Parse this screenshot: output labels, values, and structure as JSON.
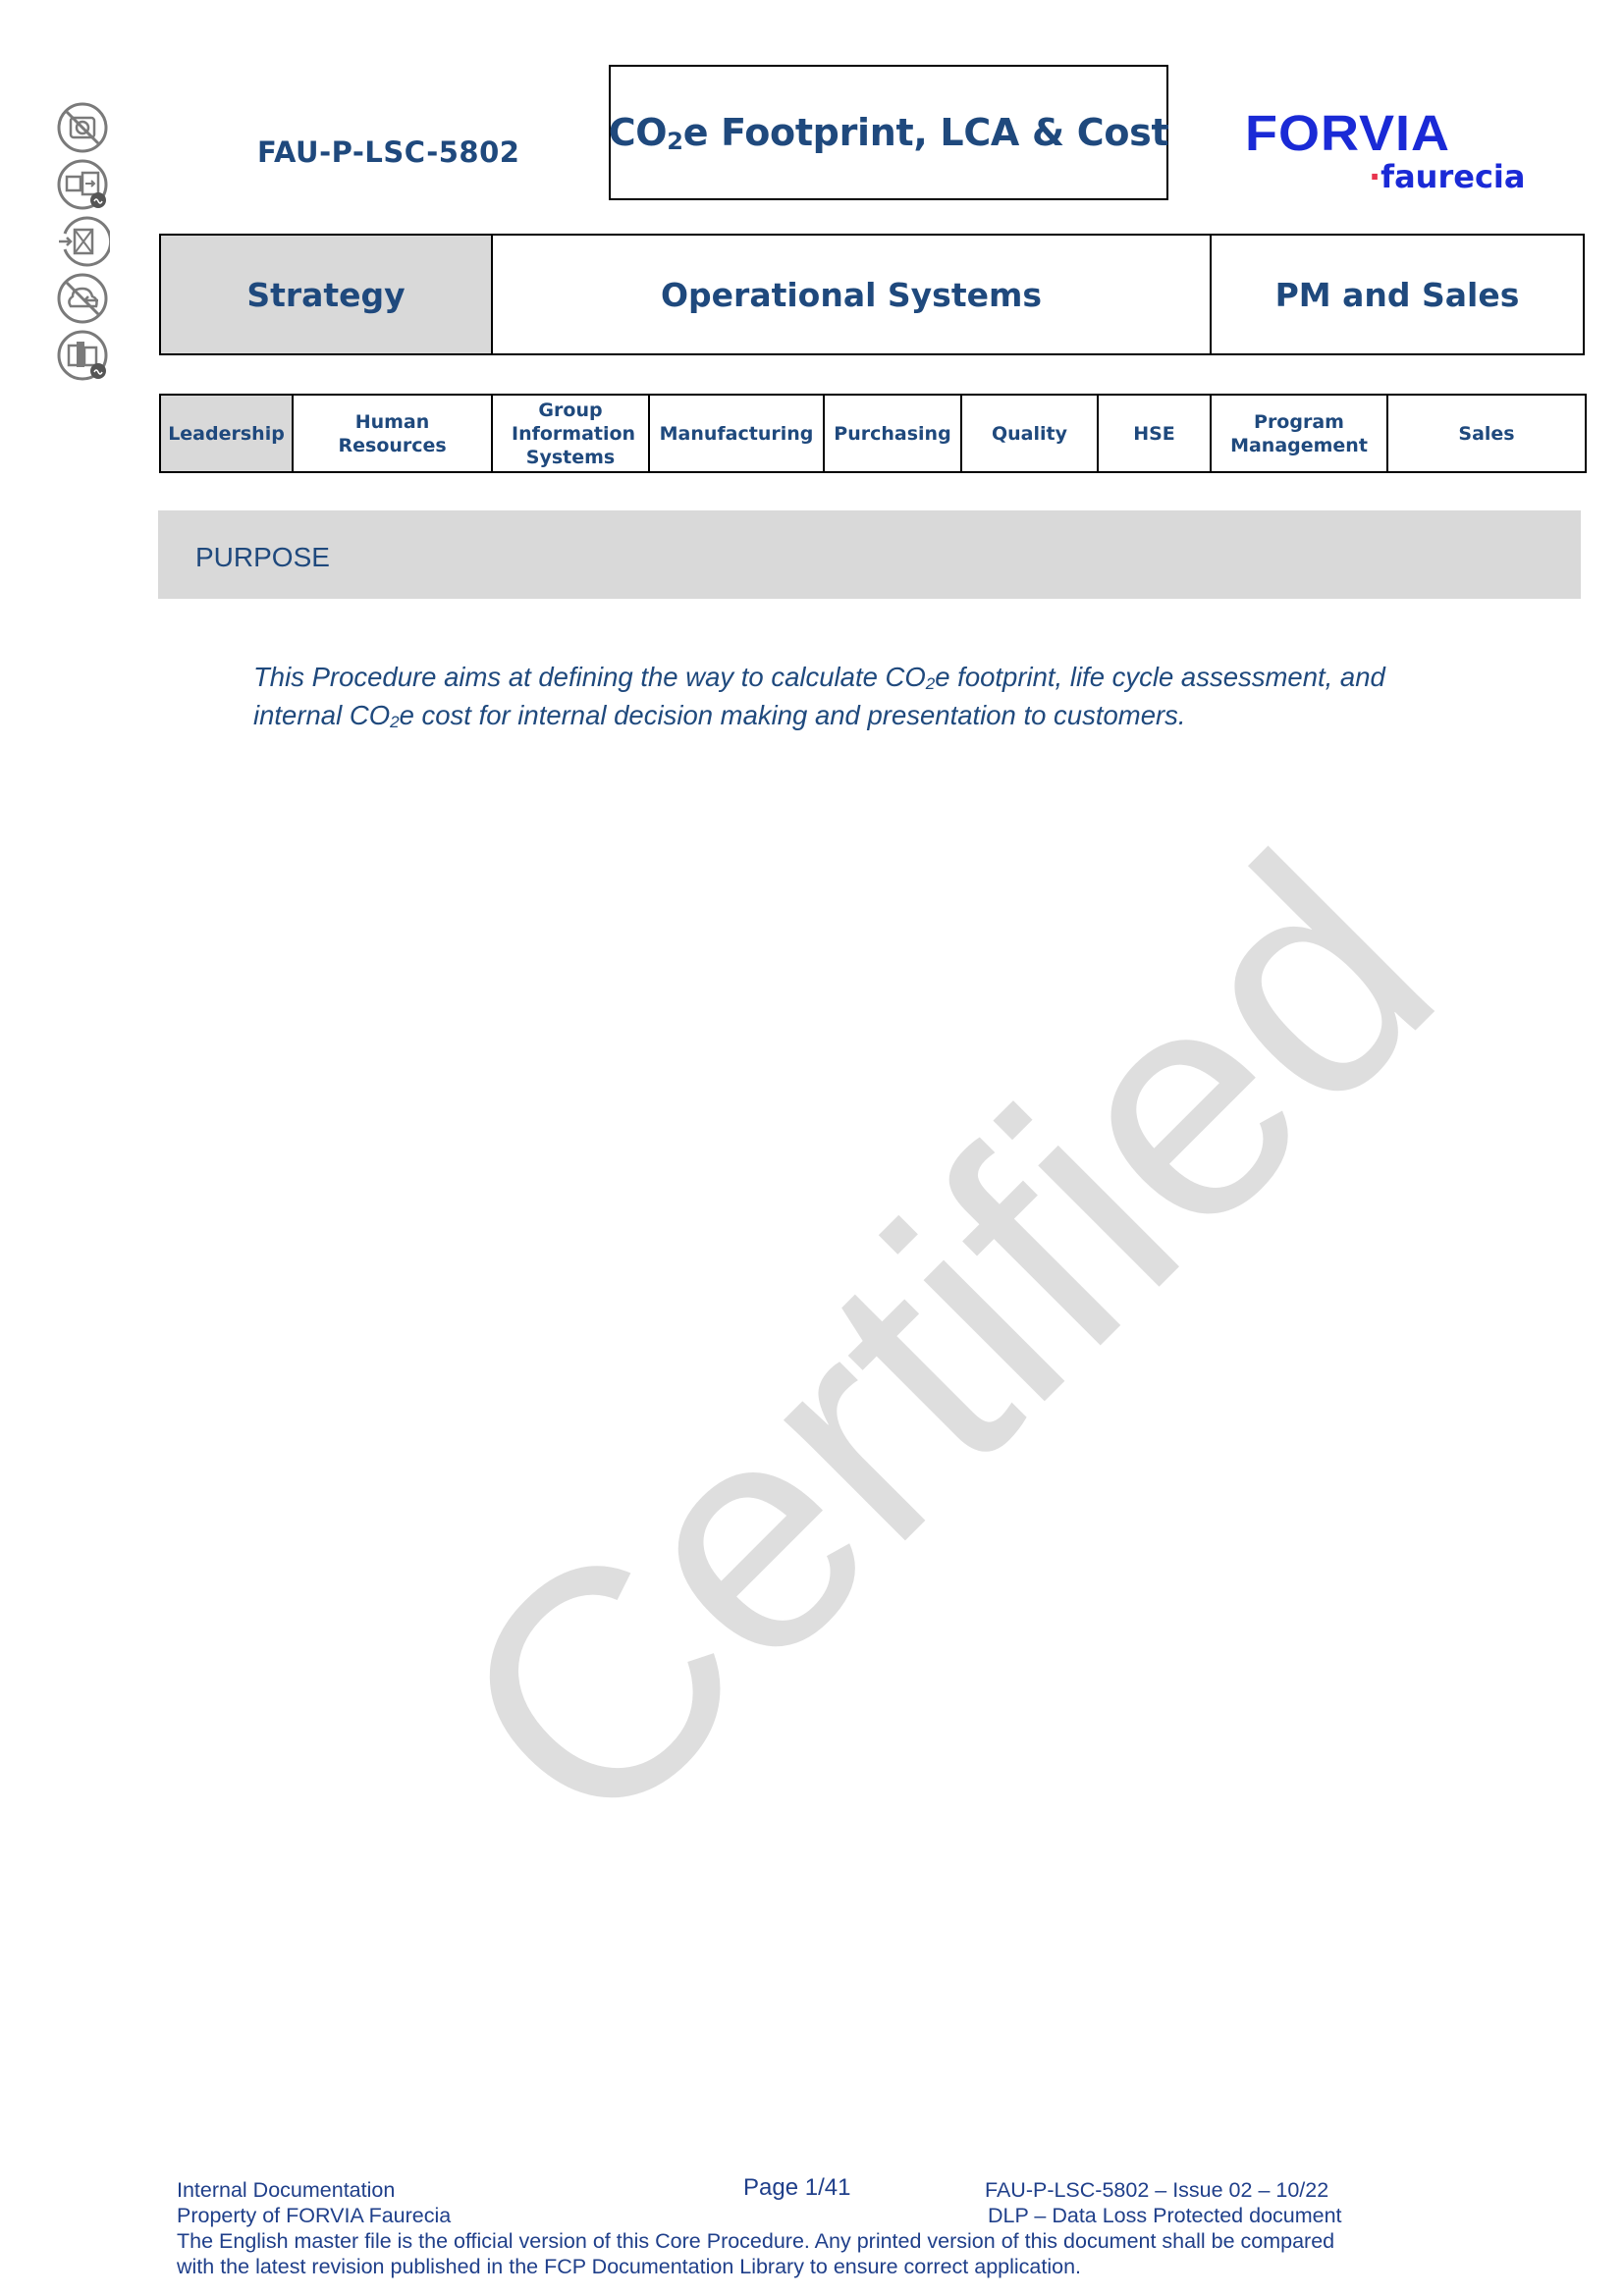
{
  "side_icons": [
    {
      "name": "no-camera-icon"
    },
    {
      "name": "no-usb-transfer-icon"
    },
    {
      "name": "no-email-forward-icon"
    },
    {
      "name": "no-cloud-upload-icon"
    },
    {
      "name": "no-print-copy-icon"
    }
  ],
  "header": {
    "doc_id": "FAU-P-LSC-5802",
    "title_prefix": "CO",
    "title_sub": "2",
    "title_suffix": "e Footprint, LCA & Cost",
    "logo_brand": "FORVIA",
    "logo_dot": "·",
    "logo_sub": "faurecia",
    "brand_color": "#1a2ad6",
    "brand_dot_color": "#e8344e"
  },
  "categories": [
    {
      "label": "Strategy",
      "active": true
    },
    {
      "label": "Operational Systems",
      "active": false
    },
    {
      "label": "PM and Sales",
      "active": false
    }
  ],
  "departments": [
    {
      "label": "Leadership",
      "active": true
    },
    {
      "label": "Human Resources",
      "active": false
    },
    {
      "label": "Group Information Systems",
      "active": false
    },
    {
      "label": "Manufacturing",
      "active": false
    },
    {
      "label": "Purchasing",
      "active": false
    },
    {
      "label": "Quality",
      "active": false
    },
    {
      "label": "HSE",
      "active": false
    },
    {
      "label": "Program Management",
      "active": false
    },
    {
      "label": "Sales",
      "active": false
    }
  ],
  "purpose": {
    "heading": "PURPOSE",
    "line1_a": "This Procedure aims at defining the way to calculate CO",
    "line1_sub": "2",
    "line1_b": "e footprint, life cycle assessment, and",
    "line2_a": "internal CO",
    "line2_sub": "2",
    "line2_b": "e cost for internal decision making and presentation to customers."
  },
  "watermark": "Certified",
  "footer": {
    "internal": "Internal Documentation",
    "property": "Property of FORVIA Faurecia",
    "page": "Page 1/41",
    "issue": "FAU-P-LSC-5802 – Issue 02 – 10/22",
    "dlp": "DLP – Data Loss Protected document",
    "notice_line1": "The English master file is the official version of this Core Procedure. Any printed version of this document shall be compared",
    "notice_line2": "with the latest revision published in the FCP Documentation Library to ensure correct application."
  },
  "colors": {
    "text_primary": "#1f497d",
    "active_cell": "#d9d9d9",
    "watermark": "#dedede"
  }
}
